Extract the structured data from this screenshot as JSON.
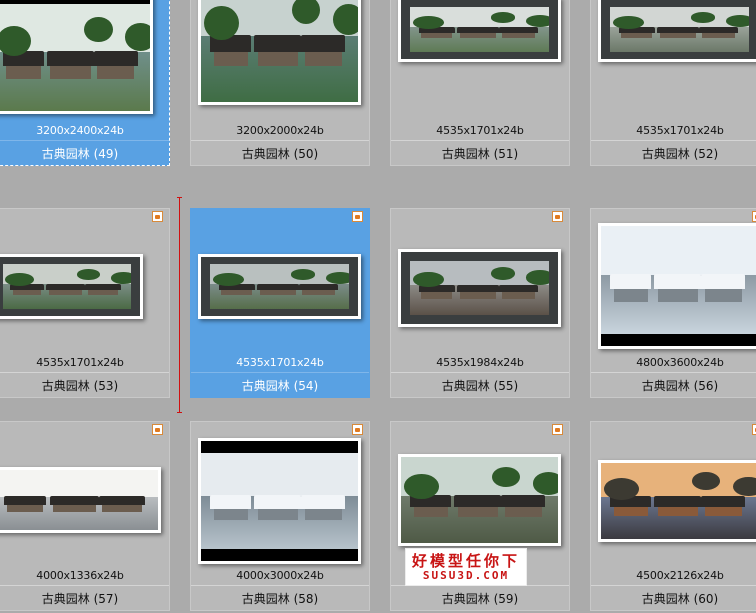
{
  "tiles": [
    {
      "dims": "3200x2400x24b",
      "caption": "古典园林 (49)",
      "selected": true,
      "focused": true,
      "scene": "garden-pavilion"
    },
    {
      "dims": "3200x2000x24b",
      "caption": "古典园林 (50)",
      "selected": false,
      "focused": false,
      "scene": "lake-pavilion"
    },
    {
      "dims": "4535x1701x24b",
      "caption": "古典园林 (51)",
      "selected": false,
      "focused": false,
      "scene": "rockery-pond"
    },
    {
      "dims": "4535x1701x24b",
      "caption": "古典园林 (52)",
      "selected": false,
      "focused": false,
      "scene": "courtyard-wall"
    },
    {
      "dims": "4535x1701x24b",
      "caption": "古典园林 (53)",
      "selected": false,
      "focused": false,
      "scene": "panorama-garden"
    },
    {
      "dims": "4535x1701x24b",
      "caption": "古典园林 (54)",
      "selected": true,
      "focused": false,
      "scene": "panorama-lake"
    },
    {
      "dims": "4535x1984x24b",
      "caption": "古典园林 (55)",
      "selected": false,
      "focused": false,
      "scene": "street-buildings"
    },
    {
      "dims": "4800x3600x24b",
      "caption": "古典园林 (56)",
      "selected": false,
      "focused": false,
      "scene": "snow-aerial"
    },
    {
      "dims": "4000x1336x24b",
      "caption": "古典园林 (57)",
      "selected": false,
      "focused": false,
      "scene": "ink-riverside"
    },
    {
      "dims": "4000x3000x24b",
      "caption": "古典园林 (58)",
      "selected": false,
      "focused": false,
      "scene": "snow-village"
    },
    {
      "dims": "",
      "caption": "古典园林 (59)",
      "selected": false,
      "focused": false,
      "scene": "old-street"
    },
    {
      "dims": "4500x2126x24b",
      "caption": "古典园林 (60)",
      "selected": false,
      "focused": false,
      "scene": "dusk-waterfront"
    }
  ],
  "watermark": {
    "line1": "好模型任你下",
    "line2": "SUSU3D.COM"
  },
  "colors": {
    "selected": "#59a1e3",
    "tile": "#b9b9b9",
    "background": "#ababab",
    "cursor": "#d01010"
  },
  "icons": {
    "badge": "image-type-icon"
  }
}
